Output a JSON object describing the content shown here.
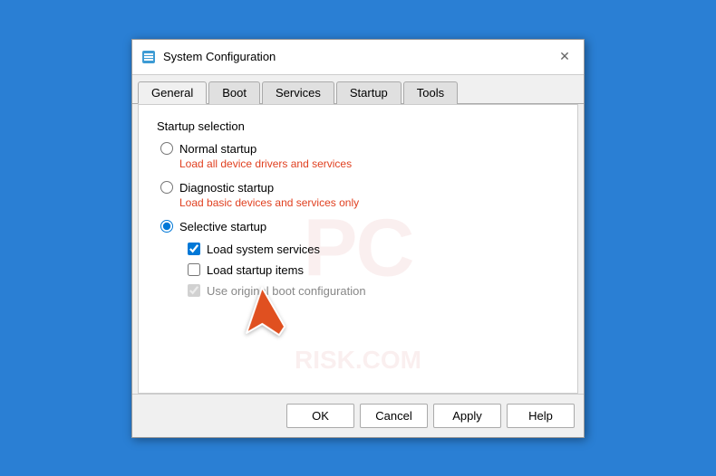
{
  "title_bar": {
    "title": "System Configuration",
    "close_label": "✕",
    "icon": "⚙"
  },
  "tabs": [
    {
      "id": "general",
      "label": "General",
      "active": true
    },
    {
      "id": "boot",
      "label": "Boot",
      "active": false
    },
    {
      "id": "services",
      "label": "Services",
      "active": false
    },
    {
      "id": "startup",
      "label": "Startup",
      "active": false
    },
    {
      "id": "tools",
      "label": "Tools",
      "active": false
    }
  ],
  "content": {
    "section_label": "Startup selection",
    "radio_options": [
      {
        "id": "normal",
        "label": "Normal startup",
        "description": "Load all device drivers and services",
        "checked": false
      },
      {
        "id": "diagnostic",
        "label": "Diagnostic startup",
        "description": "Load basic devices and services only",
        "checked": false
      },
      {
        "id": "selective",
        "label": "Selective startup",
        "description": "",
        "checked": true
      }
    ],
    "checkboxes": [
      {
        "id": "load_system_services",
        "label": "Load system services",
        "checked": true,
        "disabled": false
      },
      {
        "id": "load_startup_items",
        "label": "Load startup items",
        "checked": false,
        "disabled": false
      },
      {
        "id": "use_original_boot",
        "label": "Use original boot configuration",
        "checked": true,
        "disabled": true
      }
    ]
  },
  "footer": {
    "ok_label": "OK",
    "cancel_label": "Cancel",
    "apply_label": "Apply",
    "help_label": "Help"
  }
}
